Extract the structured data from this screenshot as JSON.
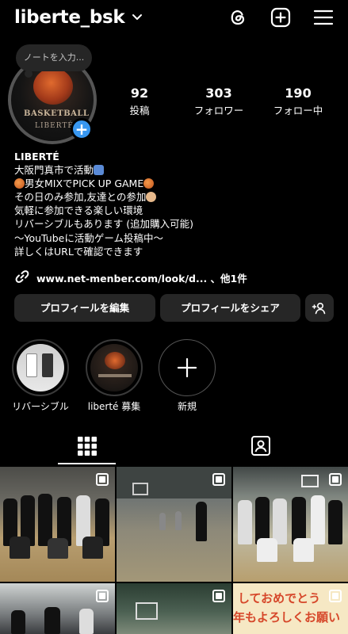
{
  "header": {
    "username": "liberte_bsk",
    "icons": [
      "chevron-down-icon",
      "threads-icon",
      "add-post-icon",
      "menu-icon"
    ]
  },
  "note": {
    "placeholder": "ノートを入力..."
  },
  "profile": {
    "avatar_text_line1": "BASKETBALL",
    "avatar_text_line2": "LIBERTÉ",
    "stats": [
      {
        "value": "92",
        "label": "投稿"
      },
      {
        "value": "303",
        "label": "フォロワー"
      },
      {
        "value": "190",
        "label": "フォロー中"
      }
    ]
  },
  "bio": {
    "name": "LIBERTÉ",
    "lines": [
      "大阪門真市で活動",
      "男女MIXでPICK UP GAME",
      "その日のみ参加,友達との参加",
      "気軽に参加できる楽しい環境",
      "リバーシブルもあります (追加購入可能)",
      "〜YouTubeに活動ゲーム投稿中〜",
      "詳しくはURLで確認できます"
    ],
    "link": "www.net-menber.com/look/d... 、他1件"
  },
  "buttons": {
    "edit_profile": "プロフィールを編集",
    "share_profile": "プロフィールをシェア"
  },
  "highlights": [
    {
      "label": "リバーシブル"
    },
    {
      "label": "liberté 募集"
    },
    {
      "label": "新規"
    }
  ],
  "tabs": [
    "grid-icon",
    "tagged-icon"
  ],
  "grid": {
    "banner_line1": "しておめでとう",
    "banner_line2": "年もよろしくお願い"
  },
  "colors": {
    "background": "#000000",
    "button_bg": "#262626",
    "accent_blue": "#3897f0"
  }
}
